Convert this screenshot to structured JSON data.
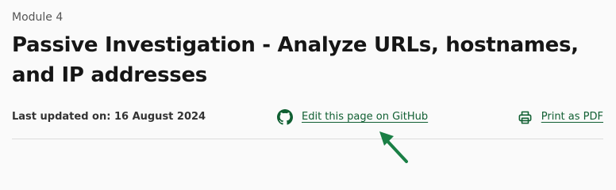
{
  "module": {
    "label": "Module 4"
  },
  "page": {
    "title": "Passive Investigation - Analyze URLs, hostnames, and IP addresses"
  },
  "meta": {
    "last_updated": "Last updated on: 16 August 2024",
    "github_link": {
      "label": "Edit this page on GitHub",
      "icon": "github-icon"
    },
    "pdf_link": {
      "label": "Print as PDF",
      "icon": "printer-icon"
    }
  },
  "annotation": {
    "icon": "arrow-icon",
    "color": "#1a7f45"
  },
  "colors": {
    "link": "#105f32",
    "title": "#161616",
    "background": "#fafafa"
  }
}
